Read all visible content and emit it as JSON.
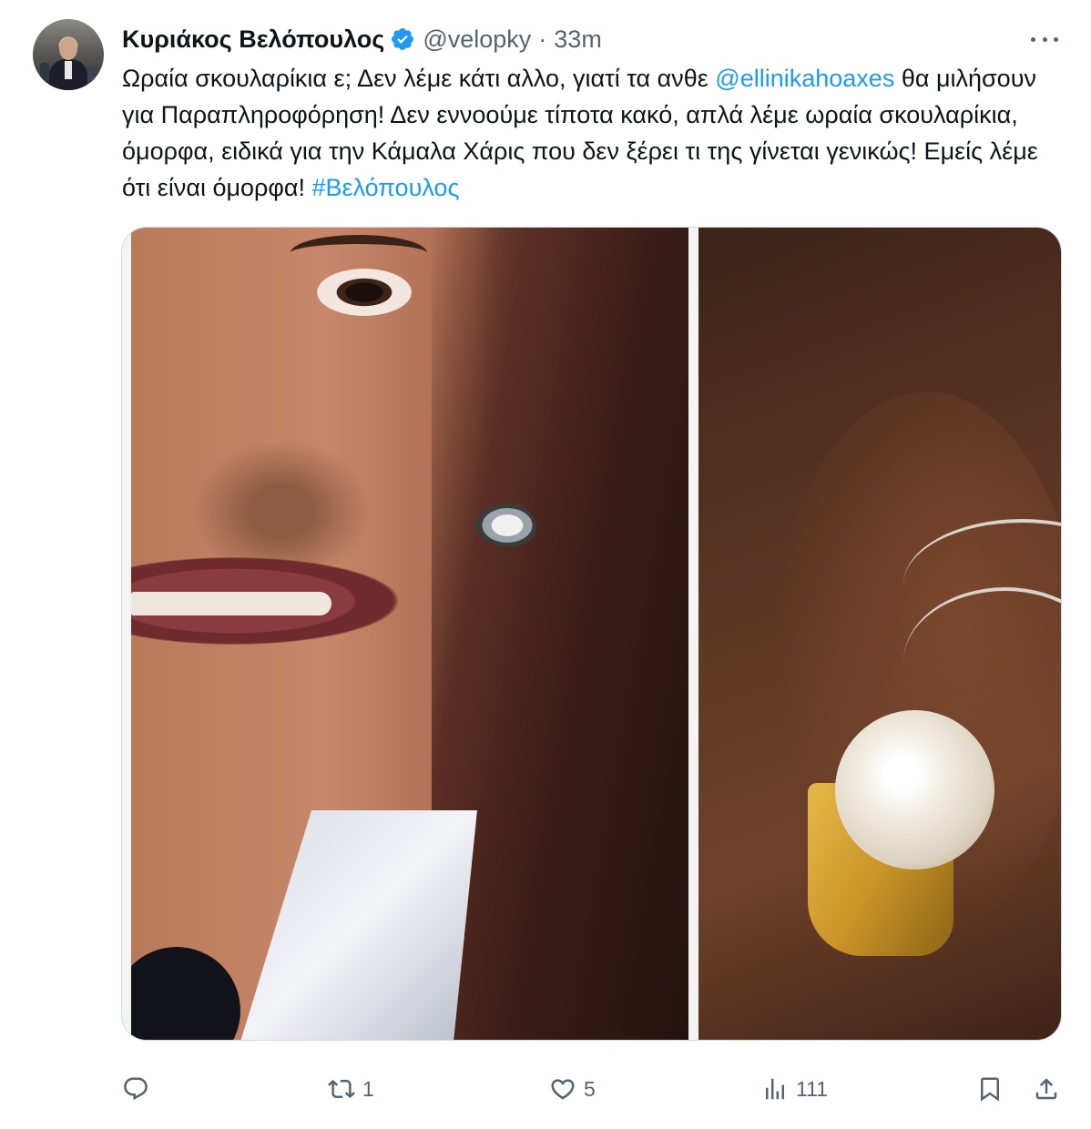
{
  "tweet": {
    "author_name": "Κυριάκος Βελόπουλος",
    "handle": "@velopky",
    "separator": "·",
    "time": "33m",
    "text_before_mention": "Ωραία σκουλαρίκια ε; Δεν λέμε κάτι αλλο, γιατί τα ανθε ",
    "mention": "@ellinikahoaxes",
    "text_after_mention": "  θα μιλήσουν για Παραπληροφόρηση! Δεν εννοούμε τίποτα κακό, απλά λέμε ωραία σκουλαρίκια, όμορφα, ειδικά για την Κάμαλα Χάρις που δεν ξέρει τι της γίνεται γενικώς! Εμείς λέμε ότι είναι όμορφα! ",
    "hashtag": "#Βελόπουλος"
  },
  "actions": {
    "reply_count": "",
    "retweet_count": "1",
    "like_count": "5",
    "views_count": "111"
  },
  "colors": {
    "link": "#1d9bf0",
    "secondary_text": "#536471",
    "verified_badge": "#1d9bf0"
  },
  "icons": [
    "verified-badge-icon",
    "more-icon",
    "reply-icon",
    "retweet-icon",
    "like-icon",
    "views-icon",
    "bookmark-icon",
    "share-icon"
  ]
}
